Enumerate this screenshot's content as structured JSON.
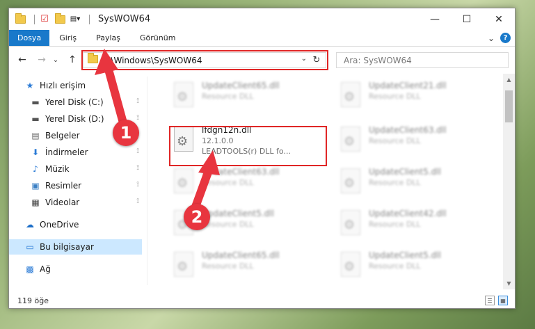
{
  "window": {
    "title": "SysWOW64",
    "controls": {
      "minimize": "—",
      "maximize": "☐",
      "close": "✕"
    }
  },
  "ribbon": {
    "tabs": [
      "Dosya",
      "Giriş",
      "Paylaş",
      "Görünüm"
    ],
    "expand": "⌄",
    "help": "?"
  },
  "nav": {
    "back": "←",
    "forward": "→",
    "recent": "⌄",
    "up": "↑",
    "address": "C:\\Windows\\SysWOW64",
    "address_dropdown": "⌄",
    "refresh": "↻",
    "search_placeholder": "Ara: SysWOW64"
  },
  "sidebar": {
    "items": [
      {
        "label": "Hızlı erişim",
        "icon": "star-icon",
        "glyph": "★",
        "color": "#2b7bd6"
      },
      {
        "label": "Yerel Disk (C:)",
        "icon": "drive-icon",
        "glyph": "▬",
        "color": "#555555",
        "pinned": true
      },
      {
        "label": "Yerel Disk (D:)",
        "icon": "drive-icon",
        "glyph": "▬",
        "color": "#555555",
        "pinned": true
      },
      {
        "label": "Belgeler",
        "icon": "documents-icon",
        "glyph": "▤",
        "color": "#6a6a6a",
        "pinned": true
      },
      {
        "label": "İndirmeler",
        "icon": "download-icon",
        "glyph": "⬇",
        "color": "#2b7bd6",
        "pinned": true
      },
      {
        "label": "Müzik",
        "icon": "music-icon",
        "glyph": "♪",
        "color": "#2b7bd6",
        "pinned": true
      },
      {
        "label": "Resimler",
        "icon": "pictures-icon",
        "glyph": "▣",
        "color": "#3a7fc4",
        "pinned": true
      },
      {
        "label": "Videolar",
        "icon": "video-icon",
        "glyph": "▦",
        "color": "#444444",
        "pinned": true
      },
      {
        "label": "OneDrive",
        "icon": "cloud-icon",
        "glyph": "☁",
        "color": "#1e6fc8"
      },
      {
        "label": "Bu bilgisayar",
        "icon": "computer-icon",
        "glyph": "▭",
        "color": "#2b7bd6",
        "selected": true
      },
      {
        "label": "Ağ",
        "icon": "network-icon",
        "glyph": "▩",
        "color": "#2b7bd6"
      }
    ],
    "pin_glyph": "📌"
  },
  "files": [
    {
      "name": "UpdateClient65.dll",
      "sub": "Resource DLL",
      "blurred": true
    },
    {
      "name": "UpdateClient21.dll",
      "sub": "Resource DLL",
      "blurred": true
    },
    {
      "name": "lfdgn12n.dll",
      "version": "12.1.0.0",
      "sub": "LEADTOOLS(r) DLL fo...",
      "blurred": false
    },
    {
      "name": "UpdateClient63.dll",
      "sub": "Resource DLL",
      "blurred": true
    },
    {
      "name": "UpdateClient63.dll",
      "sub": "Resource DLL",
      "blurred": true
    },
    {
      "name": "UpdateClient5.dll",
      "sub": "Resource DLL",
      "blurred": true
    },
    {
      "name": "UpdateClient5.dll",
      "sub": "Resource DLL",
      "blurred": true
    },
    {
      "name": "UpdateClient42.dll",
      "sub": "Resource DLL",
      "blurred": true
    },
    {
      "name": "UpdateClient65.dll",
      "sub": "Resource DLL",
      "blurred": true
    },
    {
      "name": "UpdateClient5.dll",
      "sub": "Resource DLL",
      "blurred": true
    }
  ],
  "status": {
    "count": "119 öğe"
  },
  "annotations": {
    "step1": "1",
    "step2": "2",
    "color": "#e02626"
  }
}
